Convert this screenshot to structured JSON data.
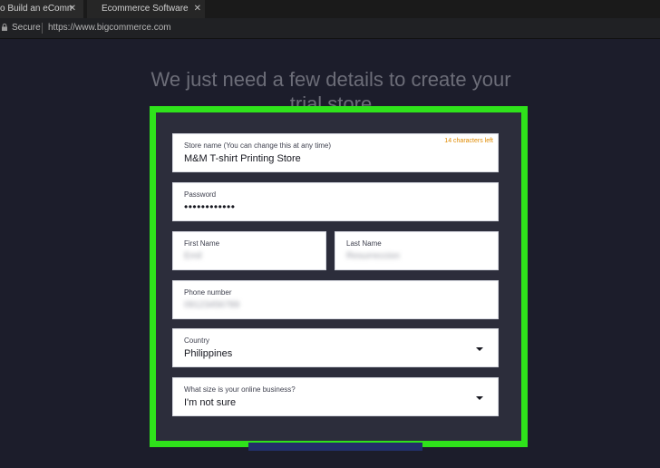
{
  "browser": {
    "tabs": [
      {
        "label": "o Build an eComme",
        "close": "✕"
      },
      {
        "label": "Ecommerce Software &",
        "close": "✕"
      }
    ],
    "address": {
      "secure_label": "Secure",
      "url": "https://www.bigcommerce.com"
    }
  },
  "page": {
    "headline": "We just need a few details to create your trial store"
  },
  "form": {
    "store_name": {
      "label": "Store name (You can change this at any time)",
      "value": "M&M T-shirt Printing Store",
      "chars_left": "14 characters left"
    },
    "password": {
      "label": "Password",
      "value": "••••••••••••"
    },
    "first_name": {
      "label": "First Name",
      "value": "Emil"
    },
    "last_name": {
      "label": "Last Name",
      "value": "Resurreccion"
    },
    "phone": {
      "label": "Phone number",
      "value": "09123456789"
    },
    "country": {
      "label": "Country",
      "value": "Philippines"
    },
    "business_size": {
      "label": "What size is your online business?",
      "value": "I'm not sure"
    }
  },
  "colors": {
    "highlight": "#2fe31b",
    "accent_chars_left": "#e08a00",
    "background": "#1c1d2b"
  }
}
